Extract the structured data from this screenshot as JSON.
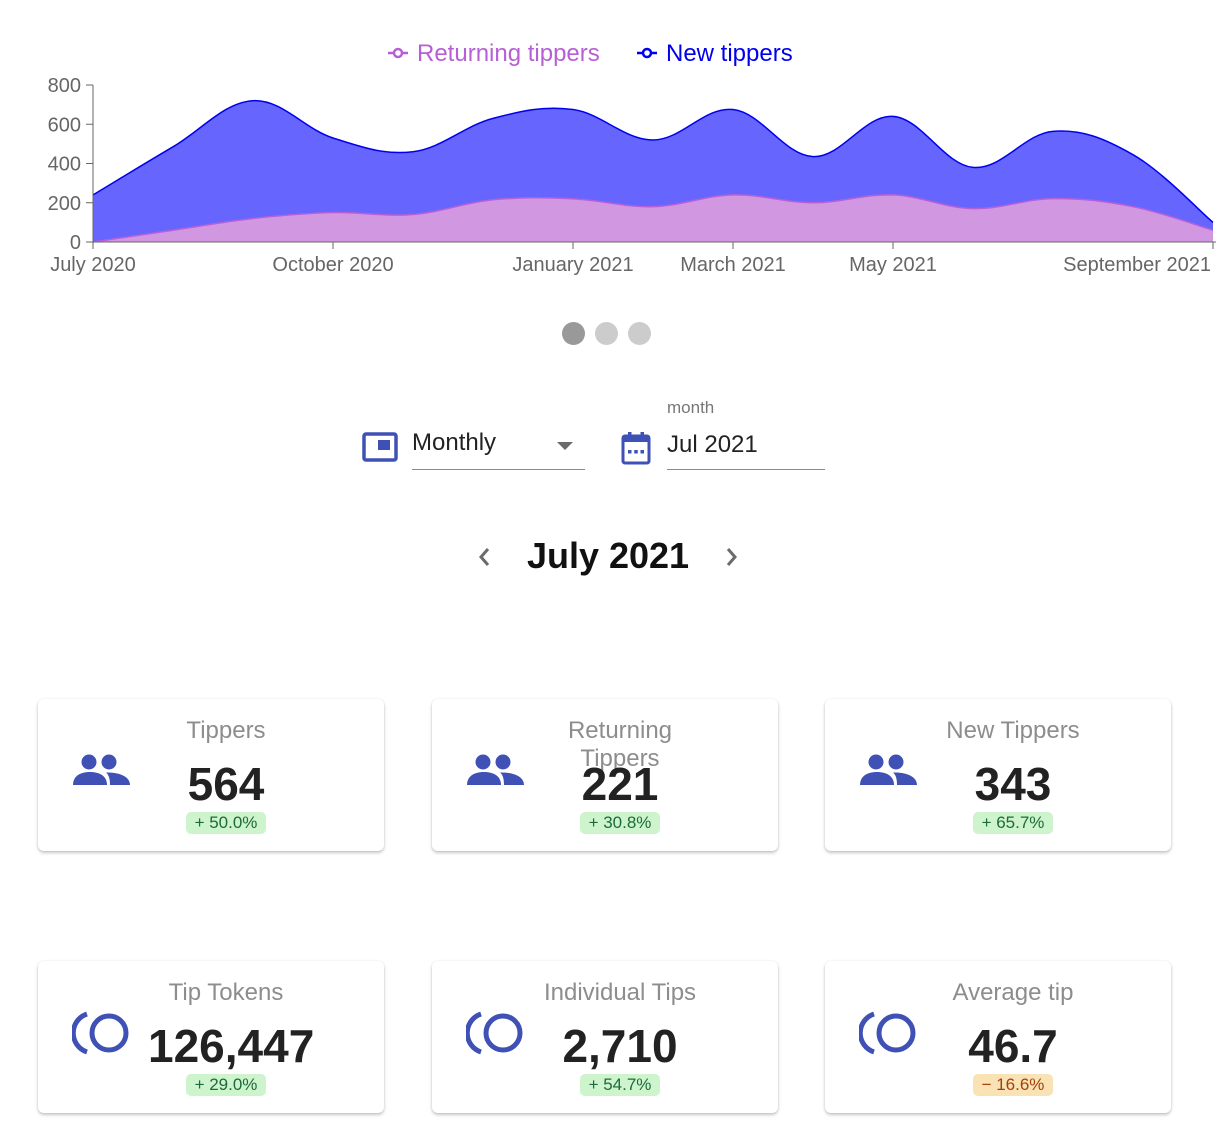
{
  "chart_data": {
    "type": "area",
    "stacked": true,
    "curve": "smooth",
    "title": "",
    "xlabel": "",
    "ylabel": "",
    "ylim": [
      0,
      800
    ],
    "yticks": [
      0,
      200,
      400,
      600,
      800
    ],
    "x": [
      "2020-07",
      "2020-08",
      "2020-09",
      "2020-10",
      "2020-11",
      "2020-12",
      "2021-01",
      "2021-02",
      "2021-03",
      "2021-04",
      "2021-05",
      "2021-06",
      "2021-07",
      "2021-08",
      "2021-09"
    ],
    "xticks": [
      {
        "x": "2020-07",
        "label": "July 2020"
      },
      {
        "x": "2020-10",
        "label": "October 2020"
      },
      {
        "x": "2021-01",
        "label": "January 2021"
      },
      {
        "x": "2021-03",
        "label": "March 2021"
      },
      {
        "x": "2021-05",
        "label": "May 2021"
      },
      {
        "x": "2021-09",
        "label": "September 2021"
      }
    ],
    "legend_position": "top",
    "series": [
      {
        "name": "Returning tippers",
        "color": "#b760d6",
        "fill": "#d197e0",
        "values": [
          0,
          60,
          120,
          150,
          140,
          215,
          220,
          180,
          240,
          200,
          240,
          170,
          221,
          180,
          60
        ]
      },
      {
        "name": "New tippers",
        "color": "#0000ee",
        "fill": "#6666ff",
        "values": [
          240,
          425,
          600,
          380,
          320,
          415,
          455,
          340,
          435,
          235,
          400,
          210,
          343,
          265,
          40
        ]
      }
    ]
  },
  "carousel": {
    "pages": 3,
    "active_index": 0
  },
  "controls": {
    "interval_select": {
      "value": "Monthly",
      "icon": "view-week-icon"
    },
    "date_field": {
      "label": "month",
      "value": "Jul 2021",
      "icon": "calendar-icon"
    }
  },
  "period_nav": {
    "title": "July 2021",
    "prev_icon": "chevron-left-icon",
    "next_icon": "chevron-right-icon"
  },
  "colors": {
    "accent": "#3f51b5",
    "positive_bg": "#cdf4cc",
    "positive_text": "#1d6a3c",
    "negative_bg": "#f9e3b5",
    "negative_text": "#a5400e"
  },
  "cards": [
    {
      "title": "Tippers",
      "value": "564",
      "change": "+ 50.0%",
      "trend": "pos",
      "icon": "people-icon"
    },
    {
      "title": "Returning Tippers",
      "value": "221",
      "change": "+ 30.8%",
      "trend": "pos",
      "icon": "people-icon"
    },
    {
      "title": "New Tippers",
      "value": "343",
      "change": "+ 65.7%",
      "trend": "pos",
      "icon": "people-icon"
    },
    {
      "title": "Tip Tokens",
      "value": "126,447",
      "change": "+ 29.0%",
      "trend": "pos",
      "icon": "token-icon"
    },
    {
      "title": "Individual Tips",
      "value": "2,710",
      "change": "+ 54.7%",
      "trend": "pos",
      "icon": "token-icon"
    },
    {
      "title": "Average tip",
      "value": "46.7",
      "change": "− 16.6%",
      "trend": "neg",
      "icon": "token-icon"
    }
  ]
}
